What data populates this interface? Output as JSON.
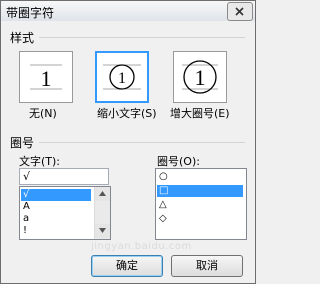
{
  "window": {
    "title": "带圈字符"
  },
  "style_group": {
    "label": "样式",
    "options": [
      {
        "caption": "无(N)",
        "selected": false
      },
      {
        "caption": "缩小文字(S)",
        "selected": true
      },
      {
        "caption": "增大圈号(E)",
        "selected": false
      }
    ],
    "preview_char": "1"
  },
  "circle_group": {
    "label": "圈号",
    "text_field": {
      "label": "文字(T):",
      "value": "√"
    },
    "text_list": {
      "items": [
        "√",
        "A",
        "a",
        "!"
      ],
      "selected_index": 0
    },
    "enclosure_field": {
      "label": "圈号(O):"
    },
    "enclosure_list": {
      "items": [
        "○",
        "□",
        "△",
        "◇"
      ],
      "selected_index": 1
    }
  },
  "buttons": {
    "ok_label": "确定",
    "cancel_label": "取消"
  },
  "watermark": {
    "text": "jingyan.baidu.com"
  },
  "colors": {
    "selection": "#3399ff",
    "dialog_bg": "#f0f0f0"
  }
}
